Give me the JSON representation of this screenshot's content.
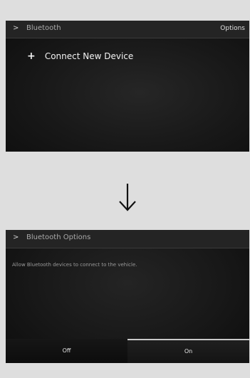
{
  "step1": {
    "header": {
      "chevron": ">",
      "title": "Bluetooth",
      "options_label": "Options"
    },
    "connect_item": {
      "icon": "plus-icon",
      "icon_glyph": "+",
      "label": "Connect New Device"
    }
  },
  "transition": {
    "icon": "down-arrow-icon"
  },
  "step2": {
    "header": {
      "chevron": ">",
      "title": "Bluetooth Options"
    },
    "description": "Allow Bluetooth devices to connect to the vehicle.",
    "toggle": {
      "off_label": "Off",
      "on_label": "On",
      "selected": "On"
    }
  }
}
